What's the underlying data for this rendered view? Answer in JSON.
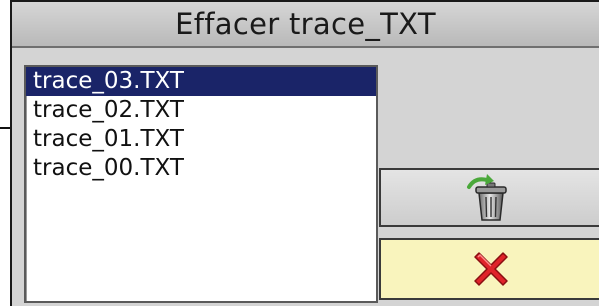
{
  "dialog": {
    "title": "Effacer trace_TXT"
  },
  "file_list": {
    "items": [
      {
        "label": "trace_03.TXT",
        "selected": true
      },
      {
        "label": "trace_02.TXT",
        "selected": false
      },
      {
        "label": "trace_01.TXT",
        "selected": false
      },
      {
        "label": "trace_00.TXT",
        "selected": false
      }
    ]
  },
  "buttons": {
    "delete_icon": "trash-can-icon",
    "cancel_icon": "red-x-icon"
  },
  "colors": {
    "selection": "#1a2468",
    "dialog_bg": "#d4d4d4",
    "cancel_bg": "#f9f4bd",
    "x_red": "#e0232a",
    "arrow_green": "#4aa83a"
  }
}
